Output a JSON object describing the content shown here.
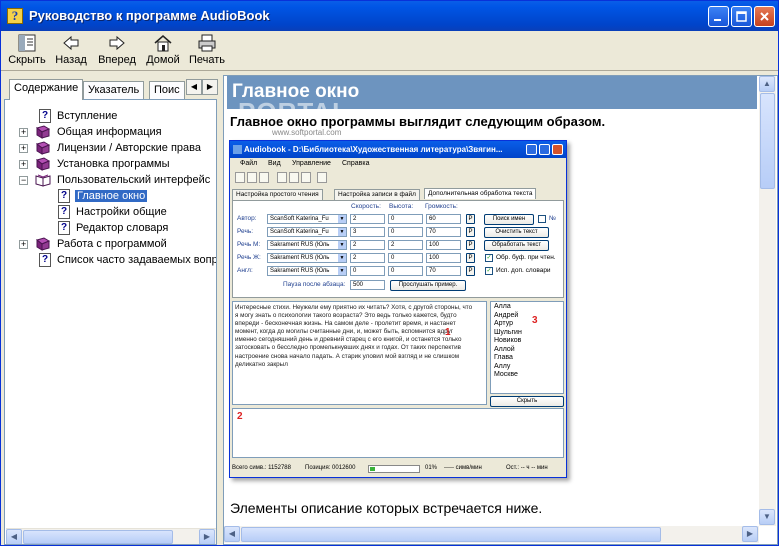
{
  "window": {
    "title": "Руководство к программе AudioBook"
  },
  "toolbar": {
    "hide": "Скрыть",
    "back": "Назад",
    "forward": "Вперед",
    "home": "Домой",
    "print": "Печать"
  },
  "tabs": {
    "contents": "Содержание",
    "index": "Указатель",
    "search": "Поис"
  },
  "tree": {
    "intro": "Вступление",
    "general": "Общая информация",
    "licenses": "Лицензии / Авторские права",
    "install": "Установка программы",
    "ui": "Пользовательский интерфейс",
    "main_window": "Главное окно",
    "general_settings": "Настройки общие",
    "dict_editor": "Редактор словаря",
    "working": "Работа с программой",
    "faq": "Список часто задаваемых вопросов"
  },
  "content": {
    "header": "Главное окно",
    "watermark": "PORTAL",
    "watermark_url": "www.softportal.com",
    "intro": "Главное окно программы выглядит следующим образом.",
    "footer": "Элементы описание которых встречается ниже."
  },
  "inner": {
    "title": "Audiobook - D:\\Библиотека\\Художественная литература\\Звягин...",
    "menu": [
      "Файл",
      "Вид",
      "Управление",
      "Справка"
    ],
    "tabs": [
      "Настройка простого чтения",
      "Настройка записи в файл",
      "Дополнительная обработка текста"
    ],
    "col_speed": "Скорость:",
    "col_height": "Высота:",
    "col_volume": "Громкость:",
    "rows": [
      {
        "label": "Автор:",
        "voice": "ScanSoft Katerina_Fu",
        "speed": "2",
        "height": "0",
        "volume": "60"
      },
      {
        "label": "Речь:",
        "voice": "ScanSoft Katerina_Fu",
        "speed": "3",
        "height": "0",
        "volume": "70"
      },
      {
        "label": "Речь М:",
        "voice": "Sakrament RUS (Юль",
        "speed": "2",
        "height": "2",
        "volume": "100"
      },
      {
        "label": "Речь Ж:",
        "voice": "Sakrament RUS (Юль",
        "speed": "2",
        "height": "0",
        "volume": "100"
      },
      {
        "label": "Англ:",
        "voice": "Sakrament RUS (Юль",
        "speed": "0",
        "height": "0",
        "volume": "70"
      }
    ],
    "pause_label": "Пауза после абзаца:",
    "pause_value": "500",
    "listen_btn": "Прослушать пример.",
    "search_names": "Поиск имен",
    "n_label": "№",
    "clear_text": "Очистить текст",
    "process_text": "Обработать текст",
    "opt_buffer": "Обр. буф. при чтен.",
    "opt_dict": "Исп. доп. словари",
    "p": "P",
    "text": "Интересные стихи. Неужели ему приятно их читать? Хотя, с другой стороны, что я могу знать о психологии такого возраста? Это ведь только кажется, будто впереди - бесконечная жизнь. На самом деле - пролетит время, и настанет момент, когда до могилы считанные дни, и, может быть, вспомнится вдруг именно сегодняшний день и древний старец с его книгой, и останется только затосковать о бесследно промелькнувших днях и годах. От таких перспектив настроение снова начало падать. А старик уловил мой взгляд и не слишком деликатно закрыл",
    "words": [
      "Алла",
      "Андрей",
      "Артур",
      "Шульгин",
      "Новиков",
      "Аллой",
      "Глава",
      "Аллу",
      "Москве"
    ],
    "hide_btn": "Скрыть",
    "n1": "1",
    "n2": "2",
    "n3": "3",
    "status_total": "Всего симв.: 1152788",
    "status_pos": "Позиция: 0012600",
    "status_pct": "01%",
    "status_speed": "----- симв/мин",
    "status_left": "Ост.: -- ч -- мин"
  }
}
